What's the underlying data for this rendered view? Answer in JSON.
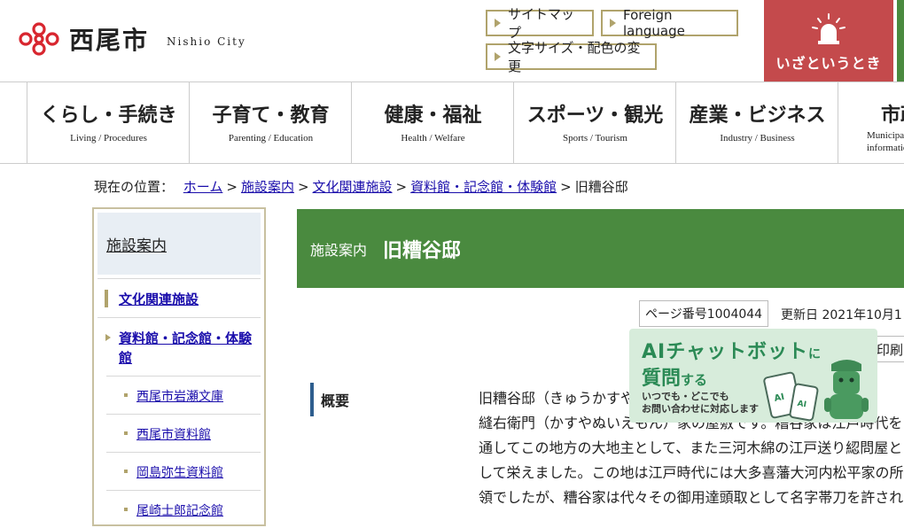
{
  "header": {
    "logo_jp": "西尾市",
    "logo_en": "Nishio City",
    "buttons": {
      "sitemap": "サイトマップ",
      "foreign": "Foreign language",
      "textsize": "文字サイズ・配色の変更"
    },
    "emergency_label": "いざというとき",
    "colors": {
      "accent_gold": "#b0a36c",
      "emergency_red": "#c44a4c",
      "brand_green": "#4a8a3f",
      "logo_red": "#d8262f"
    }
  },
  "nav": [
    {
      "jp": "くらし・手続き",
      "en": "Living / Procedures"
    },
    {
      "jp": "子育て・教育",
      "en": "Parenting / Education"
    },
    {
      "jp": "健康・福祉",
      "en": "Health / Welfare"
    },
    {
      "jp": "スポーツ・観光",
      "en": "Sports / Tourism"
    },
    {
      "jp": "産業・ビジネス",
      "en": "Industry / Business"
    },
    {
      "jp": "市政",
      "en": "Municipal information"
    }
  ],
  "breadcrumb": {
    "prefix": "現在の位置：",
    "links": [
      "ホーム",
      "施設案内",
      "文化関連施設",
      "資料館・記念館・体験館"
    ],
    "separator": ">",
    "current": "旧糟谷邸"
  },
  "sidebar": {
    "heading": "施設案内",
    "items": [
      {
        "label": "文化関連施設"
      },
      {
        "label": "資料館・記念館・体験館"
      }
    ],
    "subitems": [
      {
        "label": "西尾市岩瀬文庫"
      },
      {
        "label": "西尾市資料館"
      },
      {
        "label": "岡島弥生資料館"
      },
      {
        "label": "尾崎士郎記念館"
      }
    ]
  },
  "page": {
    "category": "施設案内",
    "title": "旧糟谷邸",
    "page_number": "ページ番号1004044",
    "updated": "更新日 2021年10月1",
    "print": "印刷",
    "section_label": "概要",
    "body_lines": [
      "旧糟谷邸（きゅうかすや",
      "縫右衛門（かすやぬいえもん）家の屋敷です。糟谷家は江戸時代を",
      "通してこの地方の大地主として、また三河木綿の江戸送り綛問屋と",
      "して栄えました。この地は江戸時代には大多喜藩大河内松平家の所",
      "領でしたが、糟谷家は代々その御用達頭取として名字帯刀を許され"
    ]
  },
  "chatbot": {
    "line1": "AIチャットボット",
    "line1_suffix": "に",
    "line2": "質問",
    "line2_suffix": "する",
    "line3": "いつでも・どこでも",
    "line4": "お問い合わせに対応します",
    "icon": "ai-chatbot-icon"
  }
}
